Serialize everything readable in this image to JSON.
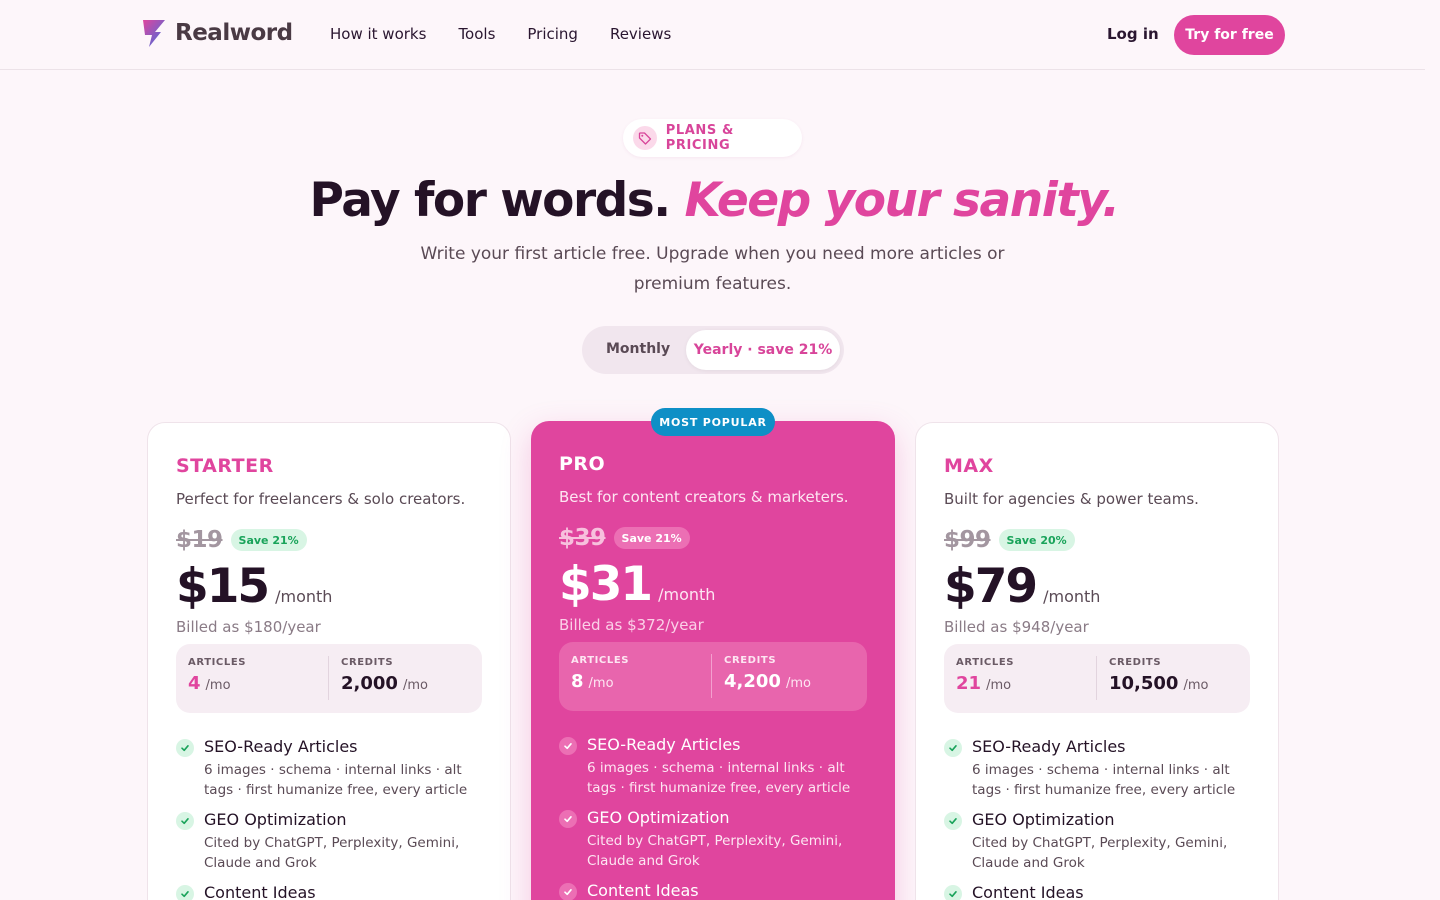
{
  "nav": {
    "brand": "Realword",
    "links": [
      "How it works",
      "Tools",
      "Pricing",
      "Reviews"
    ],
    "login": "Log in",
    "cta": "Try for free"
  },
  "hero": {
    "badge": "PLANS & PRICING",
    "title_plain": "Pay for words.",
    "title_accent": "Keep your sanity.",
    "subtitle": "Write your first article free. Upgrade when you need more articles or premium features."
  },
  "billing_toggle": {
    "monthly": "Monthly",
    "yearly": "Yearly · save 21%",
    "selected": "yearly"
  },
  "most_popular": "MOST POPULAR",
  "plans": [
    {
      "name": "STARTER",
      "description": "Perfect for freelancers & solo creators.",
      "old_price": "$19",
      "save": "Save 21%",
      "price": "$15",
      "period": "/month",
      "billed": "Billed as $180/year",
      "articles_label": "ARTICLES",
      "articles": "4",
      "credits_label": "CREDITS",
      "credits": "2,000",
      "unit": "/mo",
      "features": [
        {
          "title": "SEO-Ready Articles",
          "desc": "6 images · schema · internal links · alt tags · first humanize free, every article"
        },
        {
          "title": "GEO Optimization",
          "desc": "Cited by ChatGPT, Perplexity, Gemini, Claude and Grok"
        },
        {
          "title": "Content Ideas",
          "desc": ""
        }
      ]
    },
    {
      "name": "PRO",
      "description": "Best for content creators & marketers.",
      "old_price": "$39",
      "save": "Save 21%",
      "price": "$31",
      "period": "/month",
      "billed": "Billed as $372/year",
      "articles_label": "ARTICLES",
      "articles": "8",
      "credits_label": "CREDITS",
      "credits": "4,200",
      "unit": "/mo",
      "features": [
        {
          "title": "SEO-Ready Articles",
          "desc": "6 images · schema · internal links · alt tags · first humanize free, every article"
        },
        {
          "title": "GEO Optimization",
          "desc": "Cited by ChatGPT, Perplexity, Gemini, Claude and Grok"
        },
        {
          "title": "Content Ideas",
          "desc": ""
        }
      ]
    },
    {
      "name": "MAX",
      "description": "Built for agencies & power teams.",
      "old_price": "$99",
      "save": "Save 20%",
      "price": "$79",
      "period": "/month",
      "billed": "Billed as $948/year",
      "articles_label": "ARTICLES",
      "articles": "21",
      "credits_label": "CREDITS",
      "credits": "10,500",
      "unit": "/mo",
      "features": [
        {
          "title": "SEO-Ready Articles",
          "desc": "6 images · schema · internal links · alt tags · first humanize free, every article"
        },
        {
          "title": "GEO Optimization",
          "desc": "Cited by ChatGPT, Perplexity, Gemini, Claude and Grok"
        },
        {
          "title": "Content Ideas",
          "desc": ""
        }
      ]
    }
  ],
  "colors": {
    "accent": "#e0459e",
    "popular_badge": "#0e8fc6",
    "save_green": "#19a35a",
    "background": "#fdf6fa"
  }
}
